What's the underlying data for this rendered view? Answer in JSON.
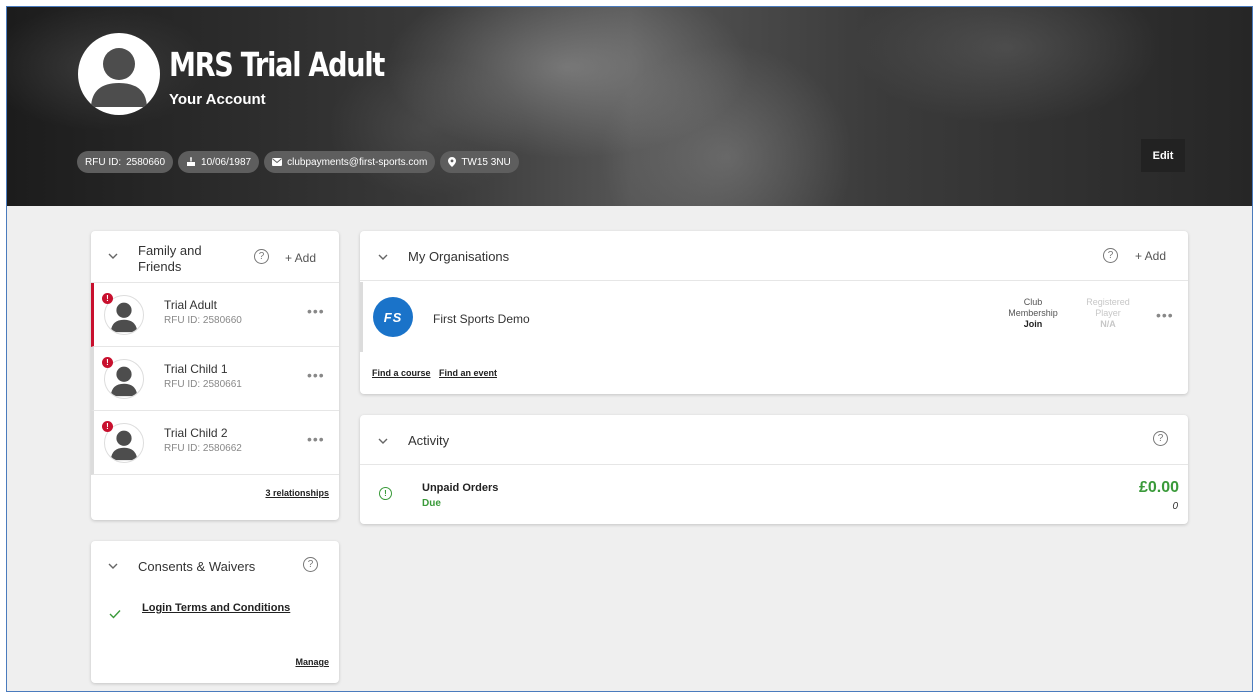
{
  "profile": {
    "name": "MRS Trial Adult",
    "subtitle": "Your Account",
    "chips": {
      "rfu_label": "RFU ID:",
      "rfu_value": "2580660",
      "dob": "10/06/1987",
      "email": "clubpayments@first-sports.com",
      "postcode": "TW15 3NU"
    },
    "edit_label": "Edit"
  },
  "family": {
    "title_line1": "Family and",
    "title_line2": "Friends",
    "add_label": "+ Add",
    "members": [
      {
        "name": "Trial Adult",
        "id": "RFU ID: 2580660",
        "alert": "!"
      },
      {
        "name": "Trial Child 1",
        "id": "RFU ID: 2580661",
        "alert": "!"
      },
      {
        "name": "Trial Child 2",
        "id": "RFU ID: 2580662",
        "alert": "!"
      }
    ],
    "relationships_link": "3 relationships"
  },
  "consents": {
    "title": "Consents & Waivers",
    "item": "Login Terms and Conditions",
    "manage_label": "Manage"
  },
  "organisations": {
    "title": "My Organisations",
    "add_label": "+ Add",
    "org": {
      "logo_text": "FS",
      "name": "First Sports Demo",
      "membership_label_1": "Club",
      "membership_label_2": "Membership",
      "membership_action": "Join",
      "registered_label_1": "Registered",
      "registered_label_2": "Player",
      "registered_value": "N/A"
    },
    "find_course": "Find a course",
    "find_event": "Find an event"
  },
  "activity": {
    "title": "Activity",
    "item_title": "Unpaid Orders",
    "item_status": "Due",
    "amount": "£0.00",
    "count": "0"
  },
  "colors": {
    "alert_red": "#c8102e",
    "success_green": "#3a9a3a",
    "org_blue": "#1a73c9"
  }
}
